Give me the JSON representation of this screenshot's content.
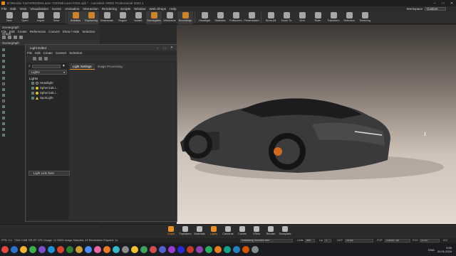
{
  "titlebar": {
    "title": "D:\\Render Car\\VRED\\McLaren 720S\\McLaren720S.vpb * - Autodesk VRED Professional 2024.1"
  },
  "menu": [
    "File",
    "Edit",
    "View",
    "Visualization",
    "Scene",
    "Animation",
    "Interaction",
    "Rendering",
    "Scripts",
    "Window",
    "Web Shops",
    "Help"
  ],
  "workspace": {
    "label": "Workspace",
    "value": "Custom"
  },
  "toolbar": [
    {
      "label": "New"
    },
    {
      "label": "Open"
    },
    {
      "label": "Import"
    },
    {
      "label": "Save"
    },
    {
      "label": "Antialias",
      "on": true
    },
    {
      "label": "Raytracing",
      "on": true
    },
    {
      "label": "Downscale"
    },
    {
      "label": "Region"
    },
    {
      "label": "Isolate"
    },
    {
      "label": "Scenegates",
      "on": true
    },
    {
      "label": "Wireframe"
    },
    {
      "label": "Boundings",
      "on": true
    },
    {
      "label": "Headlight"
    },
    {
      "label": "Statistics"
    },
    {
      "label": "Fullscreen"
    },
    {
      "label": "Presentation"
    },
    {
      "label": "Show All"
    },
    {
      "label": "Zoom To"
    },
    {
      "label": "Grid"
    },
    {
      "label": "Ruler"
    },
    {
      "label": "Transform"
    },
    {
      "label": "Selection"
    },
    {
      "label": "Texturing"
    }
  ],
  "scenegraph": {
    "title": "Scenegraph",
    "menu": [
      "File",
      "Edit",
      "Create",
      "References",
      "Convert",
      "Show / Hide",
      "Selection"
    ],
    "graph_tab": "Graph"
  },
  "light_editor": {
    "title": "Light Editor",
    "menu": [
      "File",
      "Edit",
      "Create",
      "Convert",
      "Selection"
    ],
    "filter": "Lights",
    "lights_header": "Lights",
    "lights": [
      {
        "name": "Headlight",
        "type": "headlight"
      },
      {
        "name": "SphericalLi...",
        "type": "bulb"
      },
      {
        "name": "SphericalLi...",
        "type": "bulb"
      },
      {
        "name": "SpotLight",
        "type": "spot"
      }
    ],
    "tabs": [
      "Light Settings",
      "Image Processing"
    ],
    "light_link_sets": "Light Link Sets"
  },
  "bottom_tools": [
    {
      "label": "Graph",
      "on": true
    },
    {
      "label": "Transform"
    },
    {
      "label": "Materials"
    },
    {
      "label": "Lights",
      "on": true
    },
    {
      "label": "Cameras"
    },
    {
      "label": "Curves"
    },
    {
      "label": "VSets"
    },
    {
      "label": "Render"
    },
    {
      "label": "Scenplate"
    }
  ],
  "status": {
    "fps": "FPS: 3.4",
    "mem": "7264.0 MB",
    "rt": "RR-RT CPU Usage: 12.266% Image Samples: 49 Rendertime Elapsed: 1s",
    "cmd_placeholder": "Initializing volumes tree ...",
    "units_label": "Units",
    "units": "mm",
    "up_label": "Up",
    "up": "Z",
    "ncp_label": "NCP",
    "ncp": "25.85",
    "fcp_label": "FCP",
    "fcp": "218487.50",
    "fov_label": "FOV",
    "fov": "22.62",
    "icv_label": "ICV"
  },
  "taskbar": {
    "colors": [
      "#e04a3f",
      "#2f73c9",
      "#f2b233",
      "#3bb04a",
      "#7a4fc9",
      "#1e90d6",
      "#d6442f",
      "#2f7d32",
      "#c9a03b",
      "#4c8cf5",
      "#e86aa3",
      "#ea7a2b",
      "#39b6c9",
      "#8a8a8a",
      "#f2c230",
      "#3da35a",
      "#d14d4d",
      "#5461c8",
      "#9c3bd0",
      "#2b2bd6",
      "#c0392b",
      "#8e44ad",
      "#27ae60",
      "#e67e22",
      "#16a085",
      "#2980b9",
      "#d35400",
      "#7f8c8d"
    ]
  },
  "clock": {
    "time": "9:55",
    "date": "24.01.2024",
    "lang": "ENG"
  }
}
